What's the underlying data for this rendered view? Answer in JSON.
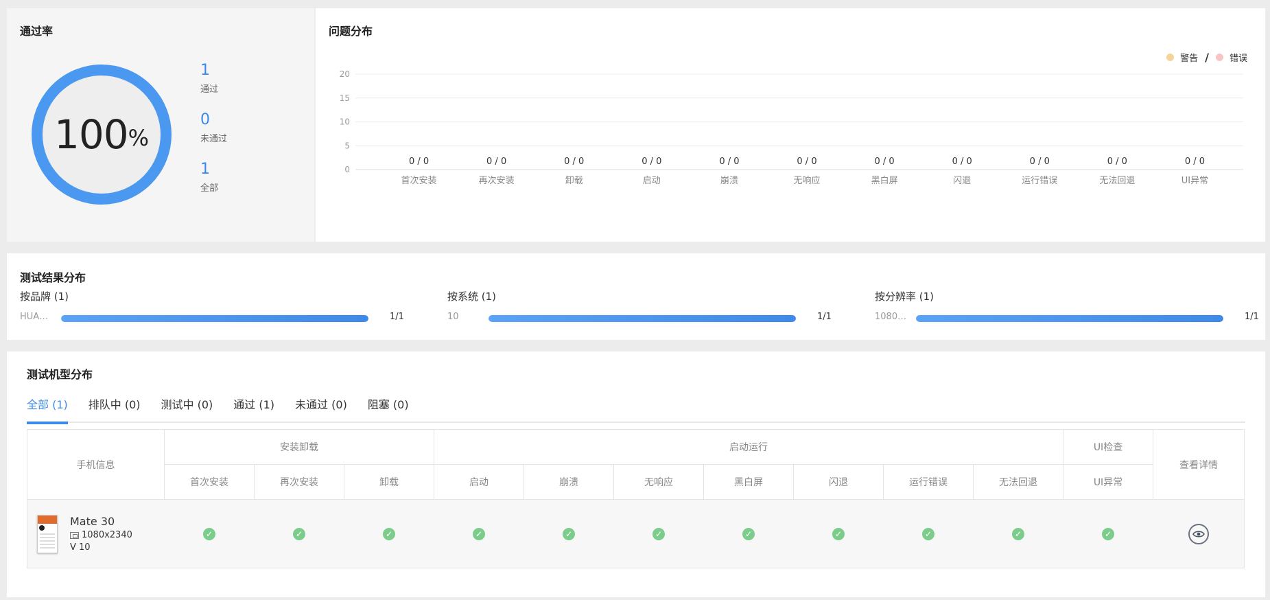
{
  "pass_rate": {
    "title": "通过率",
    "percent": 100,
    "percent_sign": "%",
    "stats": [
      {
        "value": "1",
        "label": "通过"
      },
      {
        "value": "0",
        "label": "未通过"
      },
      {
        "value": "1",
        "label": "全部"
      }
    ],
    "ring_color": "#4a98f0",
    "track_color": "#eaeaea"
  },
  "issue_distribution": {
    "title": "问题分布",
    "legend": [
      {
        "label": "警告",
        "color": "#f5d39a"
      },
      {
        "label": "错误",
        "color": "#f7c6c4"
      }
    ],
    "legend_separator": "/"
  },
  "chart_data": {
    "type": "bar",
    "categories": [
      "首次安装",
      "再次安装",
      "卸载",
      "启动",
      "崩溃",
      "无响应",
      "黑白屏",
      "闪退",
      "运行错误",
      "无法回退",
      "UI异常"
    ],
    "series": [
      {
        "name": "警告",
        "values": [
          0,
          0,
          0,
          0,
          0,
          0,
          0,
          0,
          0,
          0,
          0
        ]
      },
      {
        "name": "错误",
        "values": [
          0,
          0,
          0,
          0,
          0,
          0,
          0,
          0,
          0,
          0,
          0
        ]
      }
    ],
    "data_labels": [
      "0 / 0",
      "0 / 0",
      "0 / 0",
      "0 / 0",
      "0 / 0",
      "0 / 0",
      "0 / 0",
      "0 / 0",
      "0 / 0",
      "0 / 0",
      "0 / 0"
    ],
    "yticks": [
      0,
      5,
      10,
      15,
      20
    ],
    "ylim": [
      0,
      20
    ],
    "grid": true,
    "legend_position": "top-right"
  },
  "result_distribution": {
    "title": "测试结果分布",
    "groups": [
      {
        "heading": "按品牌 (1)",
        "name": "HUA…",
        "fraction": 1.0,
        "value": "1/1"
      },
      {
        "heading": "按系统 (1)",
        "name": "10",
        "fraction": 1.0,
        "value": "1/1"
      },
      {
        "heading": "按分辨率 (1)",
        "name": "1080…",
        "fraction": 1.0,
        "value": "1/1"
      }
    ]
  },
  "device_distribution": {
    "title": "测试机型分布",
    "tabs": [
      {
        "label": "全部 (1)",
        "active": true
      },
      {
        "label": "排队中 (0)",
        "active": false
      },
      {
        "label": "测试中 (0)",
        "active": false
      },
      {
        "label": "通过 (1)",
        "active": false
      },
      {
        "label": "未通过 (0)",
        "active": false
      },
      {
        "label": "阻塞 (0)",
        "active": false
      }
    ],
    "table": {
      "phone_info_header": "手机信息",
      "group_headers": [
        "安装卸载",
        "启动运行",
        "UI检查"
      ],
      "detail_header": "查看详情",
      "columns": [
        "首次安装",
        "再次安装",
        "卸载",
        "启动",
        "崩溃",
        "无响应",
        "黑白屏",
        "闪退",
        "运行错误",
        "无法回退",
        "UI异常"
      ],
      "rows": [
        {
          "name": "Mate 30",
          "resolution": "1080x2340",
          "version": "V 10",
          "results": [
            "pass",
            "pass",
            "pass",
            "pass",
            "pass",
            "pass",
            "pass",
            "pass",
            "pass",
            "pass",
            "pass"
          ]
        }
      ]
    },
    "check_color": "#7ccd8c"
  }
}
